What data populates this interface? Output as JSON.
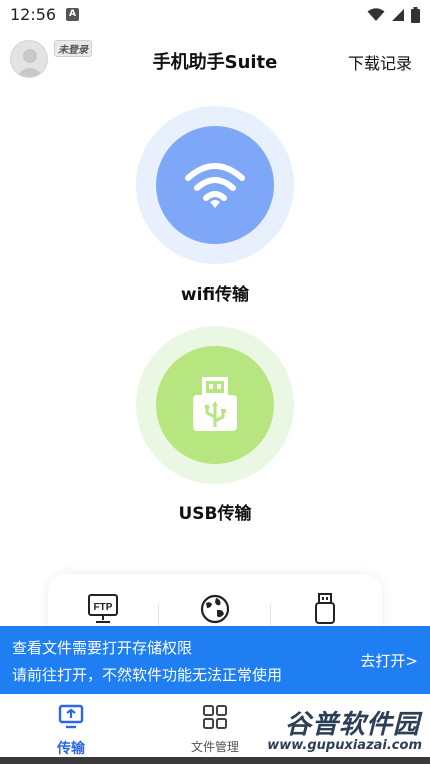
{
  "status_bar": {
    "time": "12:56",
    "app_icon_letter": "A",
    "icons": [
      "wifi-icon",
      "signal-icon",
      "battery-icon"
    ]
  },
  "header": {
    "login_badge": "未登录",
    "title": "手机助手Suite",
    "download_link": "下载记录"
  },
  "main": {
    "wifi_label": "wifi传输",
    "usb_label": "USB传输",
    "wifi_color": "#7ea7f8",
    "usb_color": "#b7e57f",
    "tools": [
      {
        "icon": "ftp-icon",
        "label": "FTP"
      },
      {
        "icon": "globe-icon"
      },
      {
        "icon": "usb-drive-icon"
      }
    ]
  },
  "permission_banner": {
    "line1": "查看文件需要打开存储权限",
    "line2": "请前往打开，不然软件功能无法正常使用",
    "action": "去打开>",
    "color": "#1f7ff2"
  },
  "bottom_nav": {
    "items": [
      {
        "label": "传输",
        "icon": "transfer-icon",
        "active": true
      },
      {
        "label": "文件管理",
        "icon": "grid-icon",
        "active": false
      }
    ],
    "accent": "#2a67e8"
  },
  "watermark": {
    "name": "谷普软件园",
    "url": "www.gupuxiazai.com"
  }
}
